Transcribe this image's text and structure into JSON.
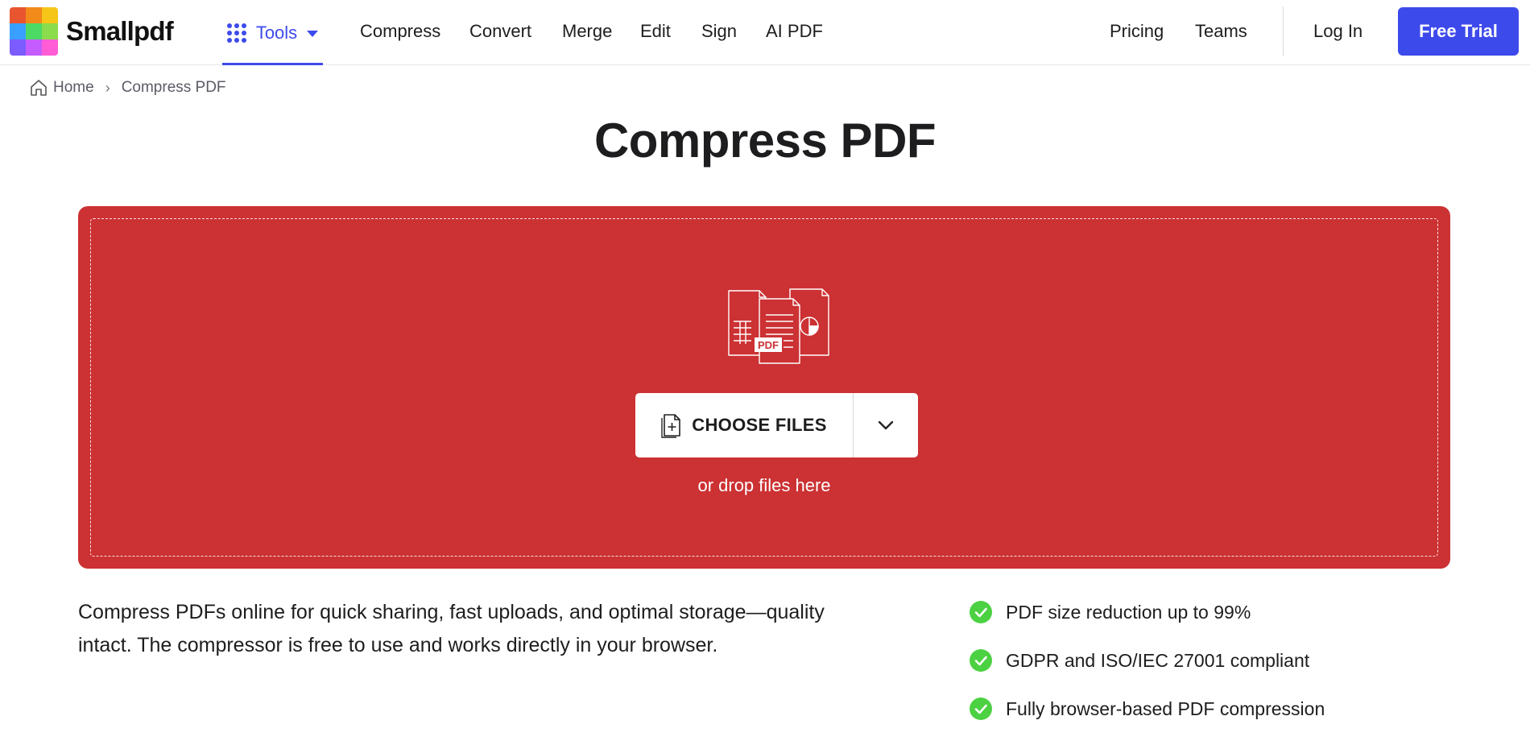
{
  "brand": {
    "name": "Smallpdf",
    "logo_colors": [
      "#e8552f",
      "#f28a1a",
      "#f5c518",
      "#3aa0ff",
      "#4cd964",
      "#8bdc4c",
      "#7b5cff",
      "#c45cff",
      "#ff5cd6"
    ]
  },
  "header": {
    "tools_label": "Tools",
    "nav": [
      "Compress",
      "Convert",
      "Merge",
      "Edit",
      "Sign",
      "AI PDF"
    ],
    "pricing": "Pricing",
    "teams": "Teams",
    "login": "Log In",
    "cta": "Free Trial",
    "accent_color": "#3d4aeb"
  },
  "breadcrumb": {
    "home": "Home",
    "separator": "›",
    "current": "Compress PDF"
  },
  "page": {
    "title": "Compress PDF"
  },
  "dropzone": {
    "background_color": "#cc3133",
    "illustration_badge": "PDF",
    "choose_label": "CHOOSE FILES",
    "hint": "or drop files here"
  },
  "description": "Compress PDFs online for quick sharing, fast uploads, and optimal storage—quality intact. The compressor is free to use and works directly in your browser.",
  "features": [
    "PDF size reduction up to 99%",
    "GDPR and ISO/IEC 27001 compliant",
    "Fully browser-based PDF compression"
  ],
  "icons": {
    "logo": "smallpdf-logo-icon",
    "tools": "grid-icon",
    "caret": "caret-down-icon",
    "home": "home-icon",
    "file_add": "file-add-icon",
    "chevron": "chevron-down-icon",
    "check": "check-circle-icon"
  },
  "check_color": "#4cd142"
}
